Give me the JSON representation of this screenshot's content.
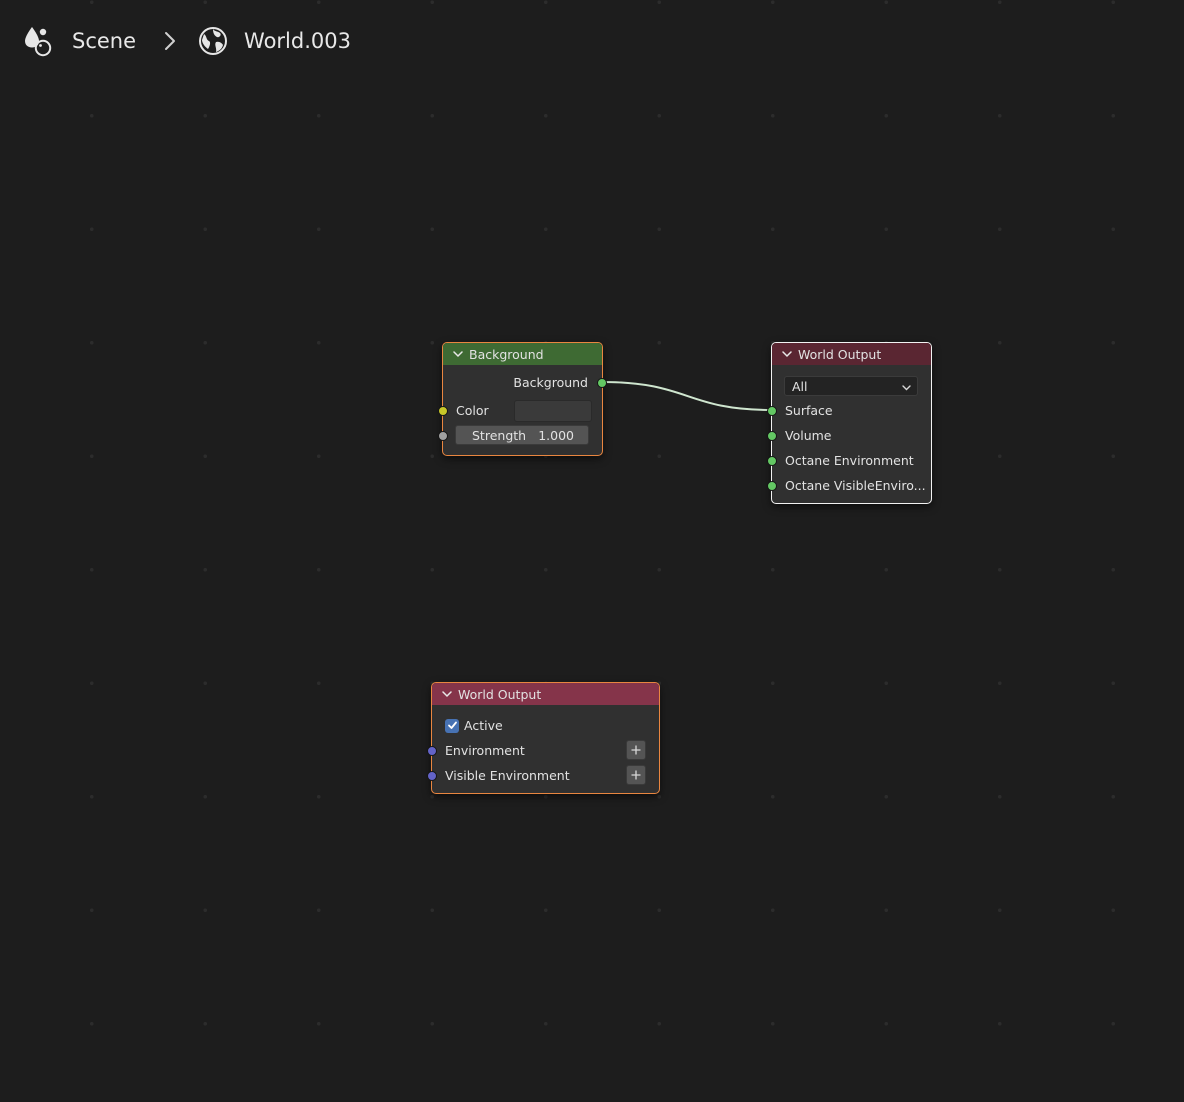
{
  "breadcrumb": {
    "scene_label": "Scene",
    "world_label": "World.003",
    "scene_icon": "scene-data-icon",
    "world_icon": "world-icon",
    "separator_icon": "chevron-right-icon"
  },
  "nodes": {
    "background": {
      "title": "Background",
      "output_label": "Background",
      "color_label": "Color",
      "strength_label": "Strength",
      "strength_value": "1.000",
      "header_color": "#3e6a33"
    },
    "world_output_cycles": {
      "title": "World Output",
      "target_value": "All",
      "inputs": [
        "Surface",
        "Volume",
        "Octane Environment",
        "Octane VisibleEnviro..."
      ],
      "header_color": "#5a2632"
    },
    "world_output_octane": {
      "title": "World Output",
      "active_label": "Active",
      "active_checked": true,
      "inputs": [
        "Environment",
        "Visible Environment"
      ],
      "header_color": "#85344a"
    }
  },
  "colors": {
    "selection_active": "#f2f2f2",
    "selection": "#e98640",
    "socket_shader": "#63c763",
    "socket_color": "#c7c729",
    "socket_float": "#a1a1a1",
    "socket_octane": "#6363c7",
    "link": "#cfe6cf"
  }
}
